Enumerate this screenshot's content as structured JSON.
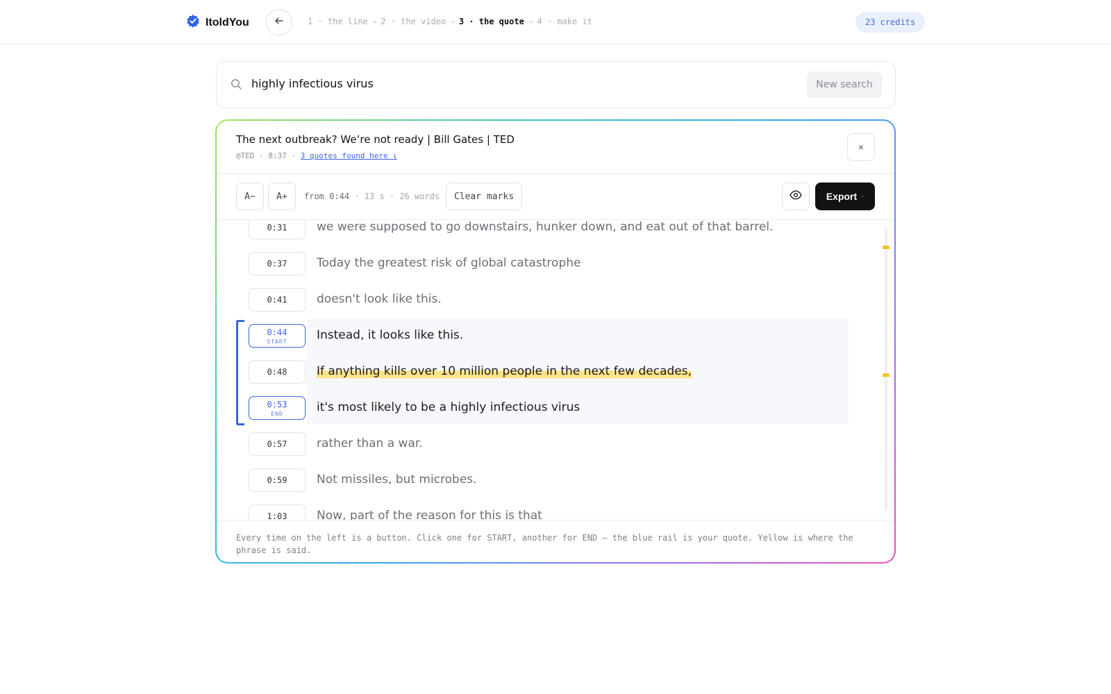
{
  "app": {
    "name": "ItoldYou"
  },
  "steps": [
    {
      "label": "1 · the line"
    },
    {
      "label": "2 · the video"
    },
    {
      "label": "3 · the quote"
    },
    {
      "label": "4 · make it"
    }
  ],
  "credits": "23 credits",
  "search": {
    "query": "highly infectious virus",
    "new_search_label": "New search"
  },
  "video": {
    "title": "The next outbreak? We’re not ready | Bill Gates | TED",
    "channel": "@TED",
    "duration": "8:37",
    "quotes_link": "3 quotes found here ↓",
    "close_label": "×"
  },
  "toolbar": {
    "font_smaller": "A−",
    "font_larger": "A+",
    "from_label": "from",
    "from_time": "0:44",
    "duration": "13 s",
    "words": "26 words",
    "clear_marks": "Clear marks",
    "export_label": "Export",
    "export_caret": "·"
  },
  "transcript": [
    {
      "time": "0:31",
      "text": "we were supposed to go downstairs, hunker down, and eat out of that barrel."
    },
    {
      "time": "0:37",
      "text": "Today the greatest risk of global catastrophe"
    },
    {
      "time": "0:41",
      "text": "doesn't look like this."
    },
    {
      "time": "0:44",
      "text": "Instead, it looks like this.",
      "mark": "START"
    },
    {
      "time": "0:48",
      "text": "If anything kills over 10 million people in the next few decades,"
    },
    {
      "time": "0:53",
      "text": "it's most likely to be a highly infectious virus",
      "mark": "END"
    },
    {
      "time": "0:57",
      "text": "rather than a war."
    },
    {
      "time": "0:59",
      "text": "Not missiles, but microbes."
    },
    {
      "time": "1:03",
      "text": "Now, part of the reason for this is that"
    }
  ],
  "footer_help": "Every time on the left is a button. Click one for START, another for END — the blue rail is your quote. Yellow is where the phrase is said.",
  "colors": {
    "accent": "#3b63e0",
    "highlight": "#fbe38a",
    "export_bg": "#111214"
  }
}
